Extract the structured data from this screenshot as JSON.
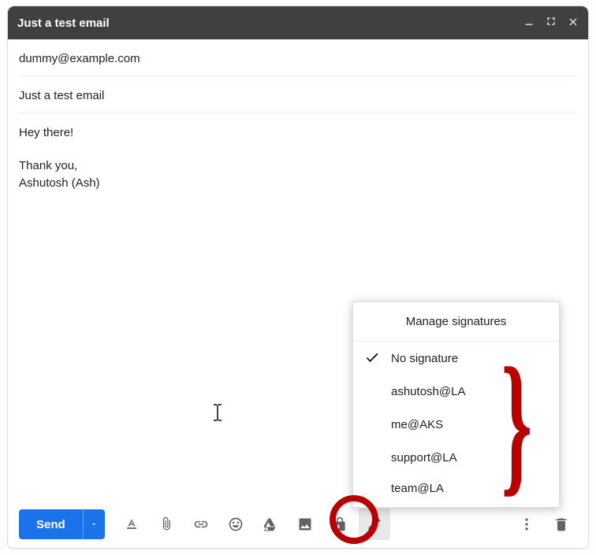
{
  "titlebar": {
    "title": "Just a test email"
  },
  "to_field": {
    "value": "dummy@example.com"
  },
  "subject_field": {
    "value": "Just a test email"
  },
  "body": {
    "greeting": "Hey there!",
    "closing_line1": "Thank you,",
    "closing_line2": "Ashutosh (Ash)"
  },
  "toolbar": {
    "send_label": "Send"
  },
  "signature_popup": {
    "header": "Manage signatures",
    "items": [
      {
        "label": "No signature",
        "checked": true
      },
      {
        "label": "ashutosh@LA",
        "checked": false
      },
      {
        "label": "me@AKS",
        "checked": false
      },
      {
        "label": "support@LA",
        "checked": false
      },
      {
        "label": "team@LA",
        "checked": false
      }
    ]
  }
}
